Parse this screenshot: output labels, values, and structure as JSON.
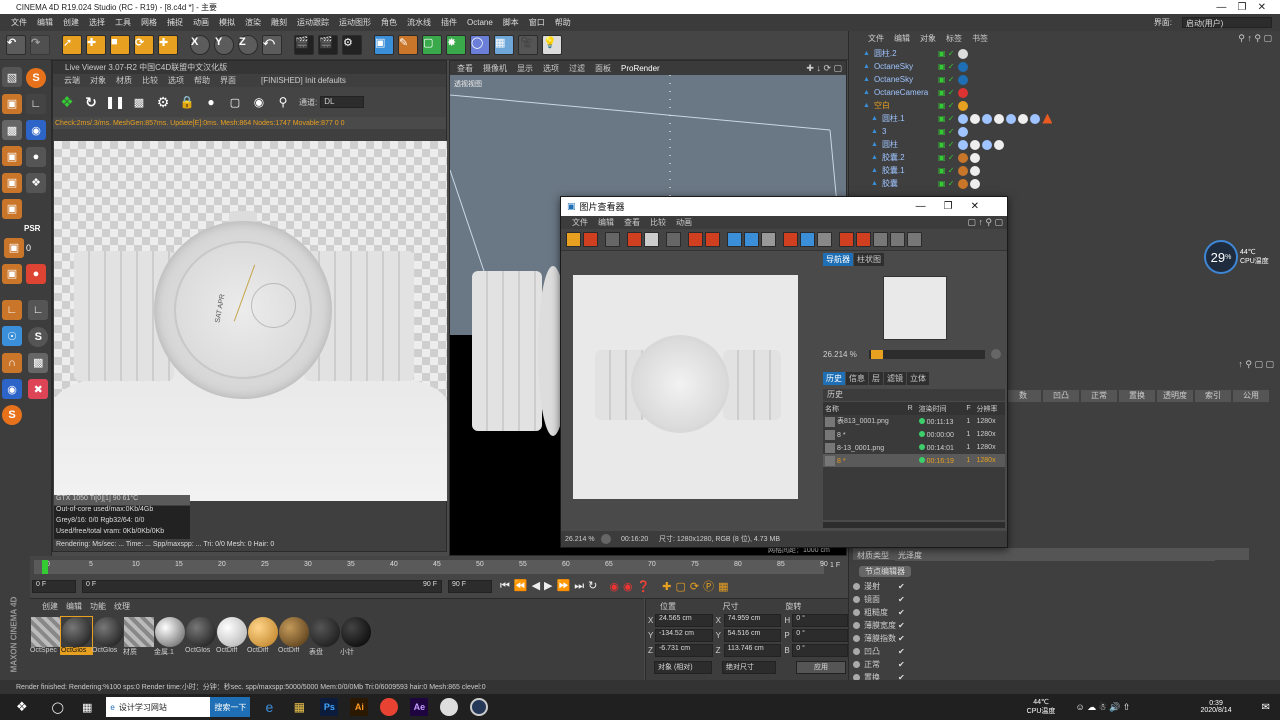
{
  "window": {
    "title": "CINEMA 4D R19.024 Studio (RC - R19) - [8.c4d *] - 主要",
    "interface_label": "界面:",
    "interface_value": "启动(用户)"
  },
  "menubar": [
    "文件",
    "编辑",
    "创建",
    "选择",
    "工具",
    "网格",
    "捕捉",
    "动画",
    "模拟",
    "渲染",
    "雕刻",
    "运动跟踪",
    "运动图形",
    "角色",
    "流水线",
    "插件",
    "Octane",
    "脚本",
    "窗口",
    "帮助"
  ],
  "toolbar": {
    "x_label": "X",
    "y_label": "Y",
    "z_label": "Z"
  },
  "left_tools": {
    "psr_label": "PSR",
    "psr_value": "0"
  },
  "live_viewer": {
    "title": "Live Viewer 3.07-R2 中国C4D联盟中文汉化版",
    "menu": [
      "云端",
      "对象",
      "材质",
      "比较",
      "选项",
      "帮助",
      "界面"
    ],
    "status_tag": "[FINISHED] Init defaults",
    "channel_label": "通道:",
    "channel_value": "DL",
    "stats": "Check:2ms/.3/ms. MeshGen:857ms. Update[E]:0ms. Mesh:864 Nodes:1747 Movable:877 0 0",
    "gpu_line": "GTX 1050 Ti[0][1]      90    61°C",
    "info": [
      "Out-of-core used/max:0Kb/4Gb",
      "Grey8/16: 0/0          Rgb32/64: 0/0",
      "Used/free/total vram: 0Kb/0Kb/0Kb"
    ],
    "render_line": "Rendering:    Ms/sec: ...  Time: ...     Spp/maxspp: ...  Tri: 0/0  Mesh: 0    Hair: 0",
    "dial_text": "SAT  APR"
  },
  "viewport": {
    "menu": [
      "查看",
      "摄像机",
      "显示",
      "选项",
      "过滤",
      "面板",
      "ProRender"
    ],
    "label": "透视视图",
    "grid_info": "网格间距：1000 cm"
  },
  "picture_viewer": {
    "title": "图片查看器",
    "menu": [
      "文件",
      "编辑",
      "查看",
      "比较",
      "动画"
    ],
    "tabs_top": [
      "导航器",
      "柱状图"
    ],
    "zoom": "26.214 %",
    "tabs_mid": [
      "历史",
      "信息",
      "层",
      "滤镜",
      "立体"
    ],
    "history_label": "历史",
    "columns": [
      "名称",
      "R",
      "渲染时间",
      "F",
      "分辨率"
    ],
    "rows": [
      {
        "name": "表813_0001.png",
        "r": "",
        "time": "00:11:13",
        "f": "1",
        "res": "1280x"
      },
      {
        "name": "8 *",
        "r": "",
        "time": "00:00:00",
        "f": "1",
        "res": "1280x"
      },
      {
        "name": "8-13_0001.png",
        "r": "",
        "time": "00:14:01",
        "f": "1",
        "res": "1280x"
      },
      {
        "name": "8 *",
        "r": "",
        "time": "00:16:19",
        "f": "1",
        "res": "1280x"
      }
    ],
    "footer_zoom": "26.214 %",
    "footer_time": "00:16:20",
    "footer_info": "尺寸: 1280x1280, RGB (8 位), 4.73 MB"
  },
  "object_manager": {
    "menu": [
      "文件",
      "编辑",
      "对象",
      "标签",
      "书签"
    ],
    "objects": [
      "圆柱.2",
      "OctaneSky",
      "OctaneSky",
      "OctaneCamera",
      "空白",
      "圆柱.1",
      "3",
      "圆柱",
      "胶囊.2",
      "胶囊.1",
      "胶囊"
    ]
  },
  "attributes": {
    "tabs": [
      "数",
      "凹凸",
      "正常",
      "置换",
      "透明度",
      "索引",
      "公用"
    ],
    "material_type_label": "材质类型",
    "material_type_value": "光泽度",
    "node_editor": "节点编辑器",
    "channels": [
      "漫射",
      "镜面",
      "粗糙度",
      "薄膜宽度",
      "薄膜指数",
      "凹凸",
      "正常",
      "置换"
    ]
  },
  "cpu": {
    "percent": "29",
    "percent_unit": "%",
    "temp": "44℃",
    "label": "CPU温度"
  },
  "timeline": {
    "ticks": [
      "0",
      "5",
      "10",
      "15",
      "20",
      "25",
      "30",
      "35",
      "40",
      "45",
      "50",
      "55",
      "60",
      "65",
      "70",
      "75",
      "80",
      "85",
      "90"
    ],
    "start": "0 F",
    "start2": "0 F",
    "end": "90 F",
    "end2": "90 F",
    "frame": "1 F"
  },
  "materials": {
    "menu": [
      "创建",
      "编辑",
      "功能",
      "纹理"
    ],
    "items": [
      "OctSpec",
      "OctGlos",
      "OctGlos",
      "材质",
      "金属.1",
      "OctGlos",
      "OctDiff",
      "OctDiff",
      "OctDiff",
      "表盘",
      "小针"
    ]
  },
  "coords": {
    "headers": [
      "位置",
      "尺寸",
      "旋转"
    ],
    "rows": [
      {
        "axis": "X",
        "pos": "24.565 cm",
        "saxis": "X",
        "size": "74.959 cm",
        "raxis": "H",
        "rot": "0 °"
      },
      {
        "axis": "Y",
        "pos": "-134.52 cm",
        "saxis": "Y",
        "size": "54.516 cm",
        "raxis": "P",
        "rot": "0 °"
      },
      {
        "axis": "Z",
        "pos": "-6.731 cm",
        "saxis": "Z",
        "size": "113.746 cm",
        "raxis": "B",
        "rot": "0 °"
      }
    ],
    "mode1": "对象 (相对)",
    "mode2": "绝对尺寸",
    "apply": "应用"
  },
  "status": "Render finished: Rendering:%100 sps:0 Render time:小时：分钟：秒sec. spp/maxspp:5000/5000 Mem:0/0/0Mb Tri:0/6009593 hair:0 Mesh:865 clevel:0",
  "maxon": "MAXON CINEMA 4D",
  "taskbar": {
    "search": "设计学习网站",
    "search_btn": "搜索一下",
    "temp": "44℃",
    "temp_label": "CPU温度",
    "time": "0:39",
    "date": "2020/8/14"
  }
}
